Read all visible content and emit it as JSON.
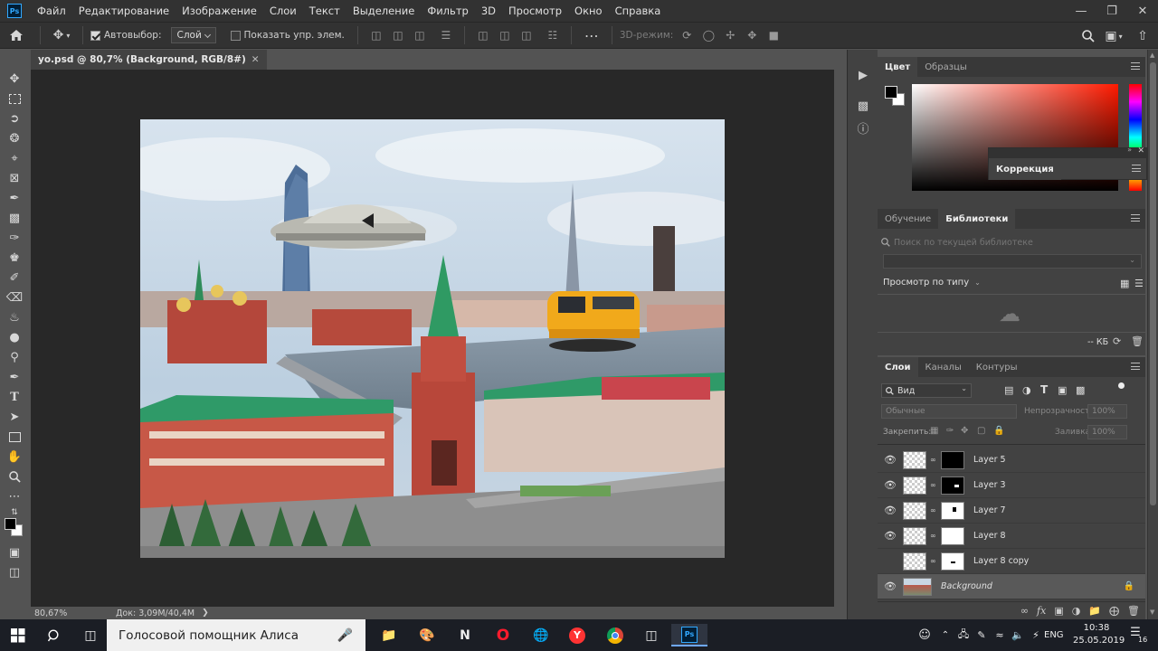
{
  "menu": {
    "items": [
      "Файл",
      "Редактирование",
      "Изображение",
      "Слои",
      "Текст",
      "Выделение",
      "Фильтр",
      "3D",
      "Просмотр",
      "Окно",
      "Справка"
    ]
  },
  "options": {
    "autoselect_label": "Автовыбор:",
    "autoselect_value": "Слой",
    "show_controls_label": "Показать упр. элем.",
    "mode_3d_label": "3D-режим:"
  },
  "document": {
    "tab_title": "yo.psd @ 80,7% (Background, RGB/8#)",
    "zoom": "80,67%",
    "doc_size": "Док: 3,09M/40,4M"
  },
  "color_panel": {
    "tabs": [
      "Цвет",
      "Образцы"
    ],
    "correction_label": "Коррекция"
  },
  "library_panel": {
    "tabs": [
      "Обучение",
      "Библиотеки"
    ],
    "search_placeholder": "Поиск по текущей библиотеке",
    "view_by_type": "Просмотр по типу",
    "size_label": "-- КБ"
  },
  "layers_panel": {
    "tabs": [
      "Слои",
      "Каналы",
      "Контуры"
    ],
    "filter_kind": "Вид",
    "blend_mode": "Обычные",
    "opacity_label": "Непрозрачность:",
    "opacity_value": "100%",
    "lock_label": "Закрепить:",
    "fill_label": "Заливка:",
    "fill_value": "100%",
    "layers": [
      {
        "name": "Layer 5",
        "visible": true
      },
      {
        "name": "Layer 3",
        "visible": true
      },
      {
        "name": "Layer 7",
        "visible": true
      },
      {
        "name": "Layer 8",
        "visible": true
      },
      {
        "name": "Layer 8 copy",
        "visible": false
      },
      {
        "name": "Background",
        "visible": true
      }
    ]
  },
  "taskbar": {
    "search_text": "Голосовой помощник Алиса",
    "language": "ENG",
    "time": "10:38",
    "date": "25.05.2019",
    "notifications": "16"
  },
  "colors": {
    "accent": "#31a8ff",
    "panel_bg": "#424242",
    "canvas_bg": "#282828"
  }
}
